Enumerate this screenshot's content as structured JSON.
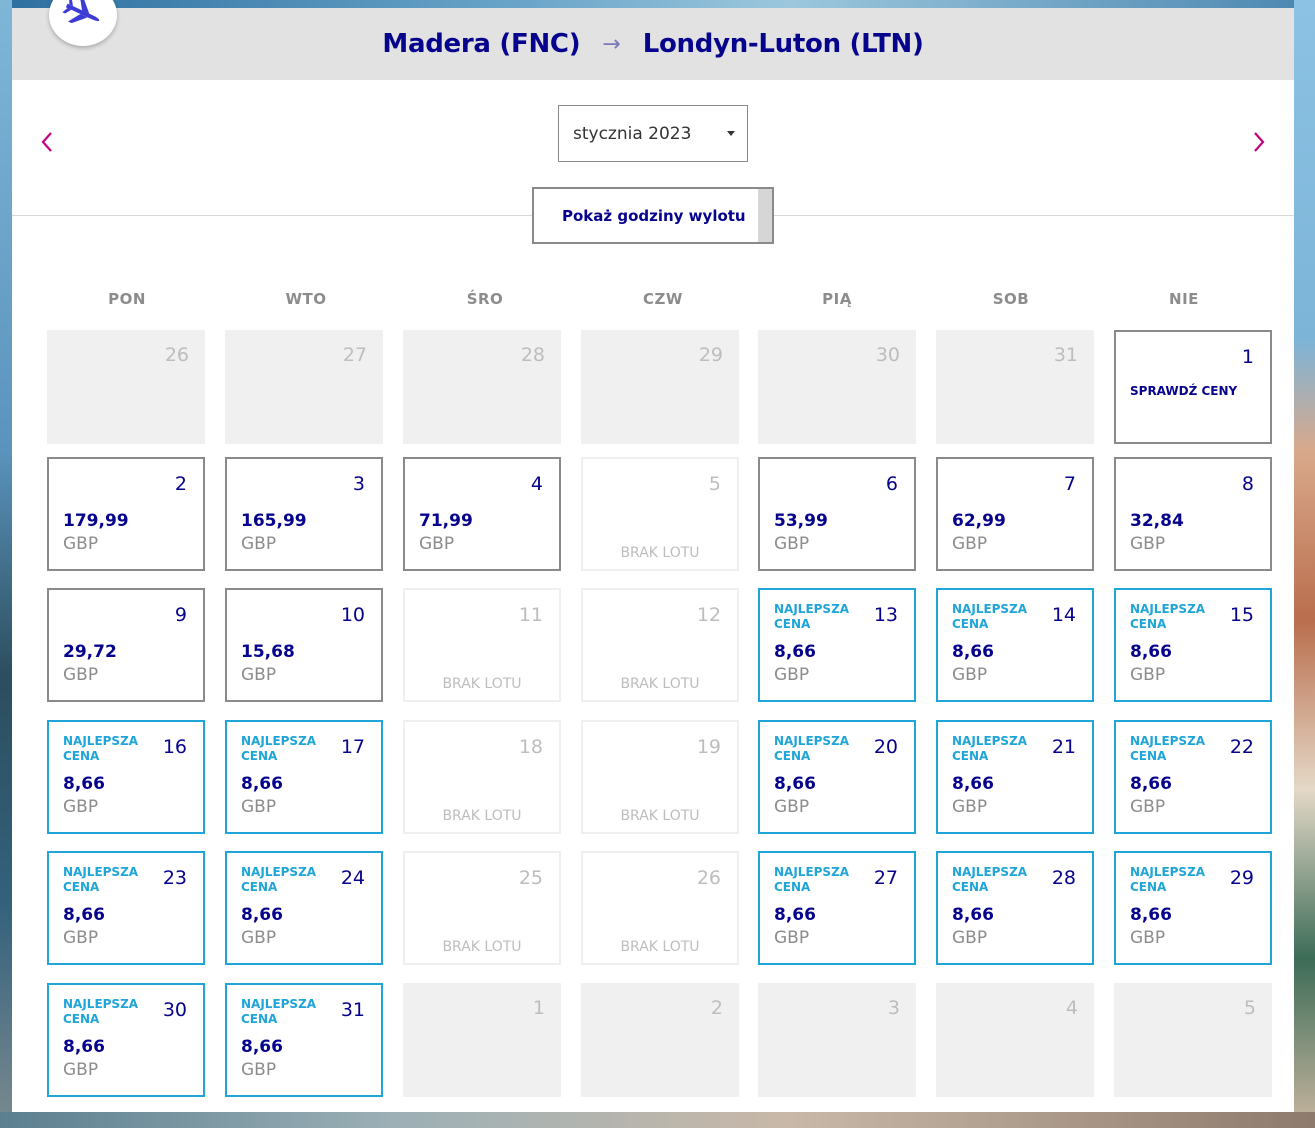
{
  "header": {
    "origin": "Madera (FNC)",
    "arrow": "→",
    "destination": "Londyn-Luton (LTN)"
  },
  "month_selector": {
    "selected": "stycznia 2023"
  },
  "show_times_button": "Pokaż godziny wylotu",
  "labels": {
    "best_price": "NAJLEPSZA CENA",
    "no_flight": "BRAK LOTU",
    "check_prices": "SPRAWDŹ CENY"
  },
  "weekdays": [
    "PON",
    "WTO",
    "ŚRO",
    "CZW",
    "PIĄ",
    "SOB",
    "NIE"
  ],
  "calendar": [
    [
      {
        "day": "26",
        "type": "outside"
      },
      {
        "day": "27",
        "type": "outside"
      },
      {
        "day": "28",
        "type": "outside"
      },
      {
        "day": "29",
        "type": "outside"
      },
      {
        "day": "30",
        "type": "outside"
      },
      {
        "day": "31",
        "type": "outside"
      },
      {
        "day": "1",
        "type": "check"
      }
    ],
    [
      {
        "day": "2",
        "type": "priced",
        "price": "179,99",
        "currency": "GBP"
      },
      {
        "day": "3",
        "type": "priced",
        "price": "165,99",
        "currency": "GBP"
      },
      {
        "day": "4",
        "type": "priced",
        "price": "71,99",
        "currency": "GBP"
      },
      {
        "day": "5",
        "type": "noflight"
      },
      {
        "day": "6",
        "type": "priced",
        "price": "53,99",
        "currency": "GBP"
      },
      {
        "day": "7",
        "type": "priced",
        "price": "62,99",
        "currency": "GBP"
      },
      {
        "day": "8",
        "type": "priced",
        "price": "32,84",
        "currency": "GBP"
      }
    ],
    [
      {
        "day": "9",
        "type": "priced",
        "price": "29,72",
        "currency": "GBP"
      },
      {
        "day": "10",
        "type": "priced",
        "price": "15,68",
        "currency": "GBP"
      },
      {
        "day": "11",
        "type": "noflight"
      },
      {
        "day": "12",
        "type": "noflight"
      },
      {
        "day": "13",
        "type": "best",
        "price": "8,66",
        "currency": "GBP"
      },
      {
        "day": "14",
        "type": "best",
        "price": "8,66",
        "currency": "GBP"
      },
      {
        "day": "15",
        "type": "best",
        "price": "8,66",
        "currency": "GBP"
      }
    ],
    [
      {
        "day": "16",
        "type": "best",
        "price": "8,66",
        "currency": "GBP"
      },
      {
        "day": "17",
        "type": "best",
        "price": "8,66",
        "currency": "GBP"
      },
      {
        "day": "18",
        "type": "noflight"
      },
      {
        "day": "19",
        "type": "noflight"
      },
      {
        "day": "20",
        "type": "best",
        "price": "8,66",
        "currency": "GBP"
      },
      {
        "day": "21",
        "type": "best",
        "price": "8,66",
        "currency": "GBP"
      },
      {
        "day": "22",
        "type": "best",
        "price": "8,66",
        "currency": "GBP"
      }
    ],
    [
      {
        "day": "23",
        "type": "best",
        "price": "8,66",
        "currency": "GBP"
      },
      {
        "day": "24",
        "type": "best",
        "price": "8,66",
        "currency": "GBP"
      },
      {
        "day": "25",
        "type": "noflight"
      },
      {
        "day": "26",
        "type": "noflight"
      },
      {
        "day": "27",
        "type": "best",
        "price": "8,66",
        "currency": "GBP"
      },
      {
        "day": "28",
        "type": "best",
        "price": "8,66",
        "currency": "GBP"
      },
      {
        "day": "29",
        "type": "best",
        "price": "8,66",
        "currency": "GBP"
      }
    ],
    [
      {
        "day": "30",
        "type": "best",
        "price": "8,66",
        "currency": "GBP"
      },
      {
        "day": "31",
        "type": "best",
        "price": "8,66",
        "currency": "GBP"
      },
      {
        "day": "1",
        "type": "outside"
      },
      {
        "day": "2",
        "type": "outside"
      },
      {
        "day": "3",
        "type": "outside"
      },
      {
        "day": "4",
        "type": "outside"
      },
      {
        "day": "5",
        "type": "outside"
      }
    ]
  ],
  "colors": {
    "brand_navy": "#06038d",
    "best_price_blue": "#1fa5d8",
    "nav_arrow_magenta": "#c6007e"
  },
  "icons": {
    "logo": "airplane-icon",
    "prev": "chevron-left-icon",
    "next": "chevron-right-icon",
    "select_caret": "caret-down-icon"
  }
}
